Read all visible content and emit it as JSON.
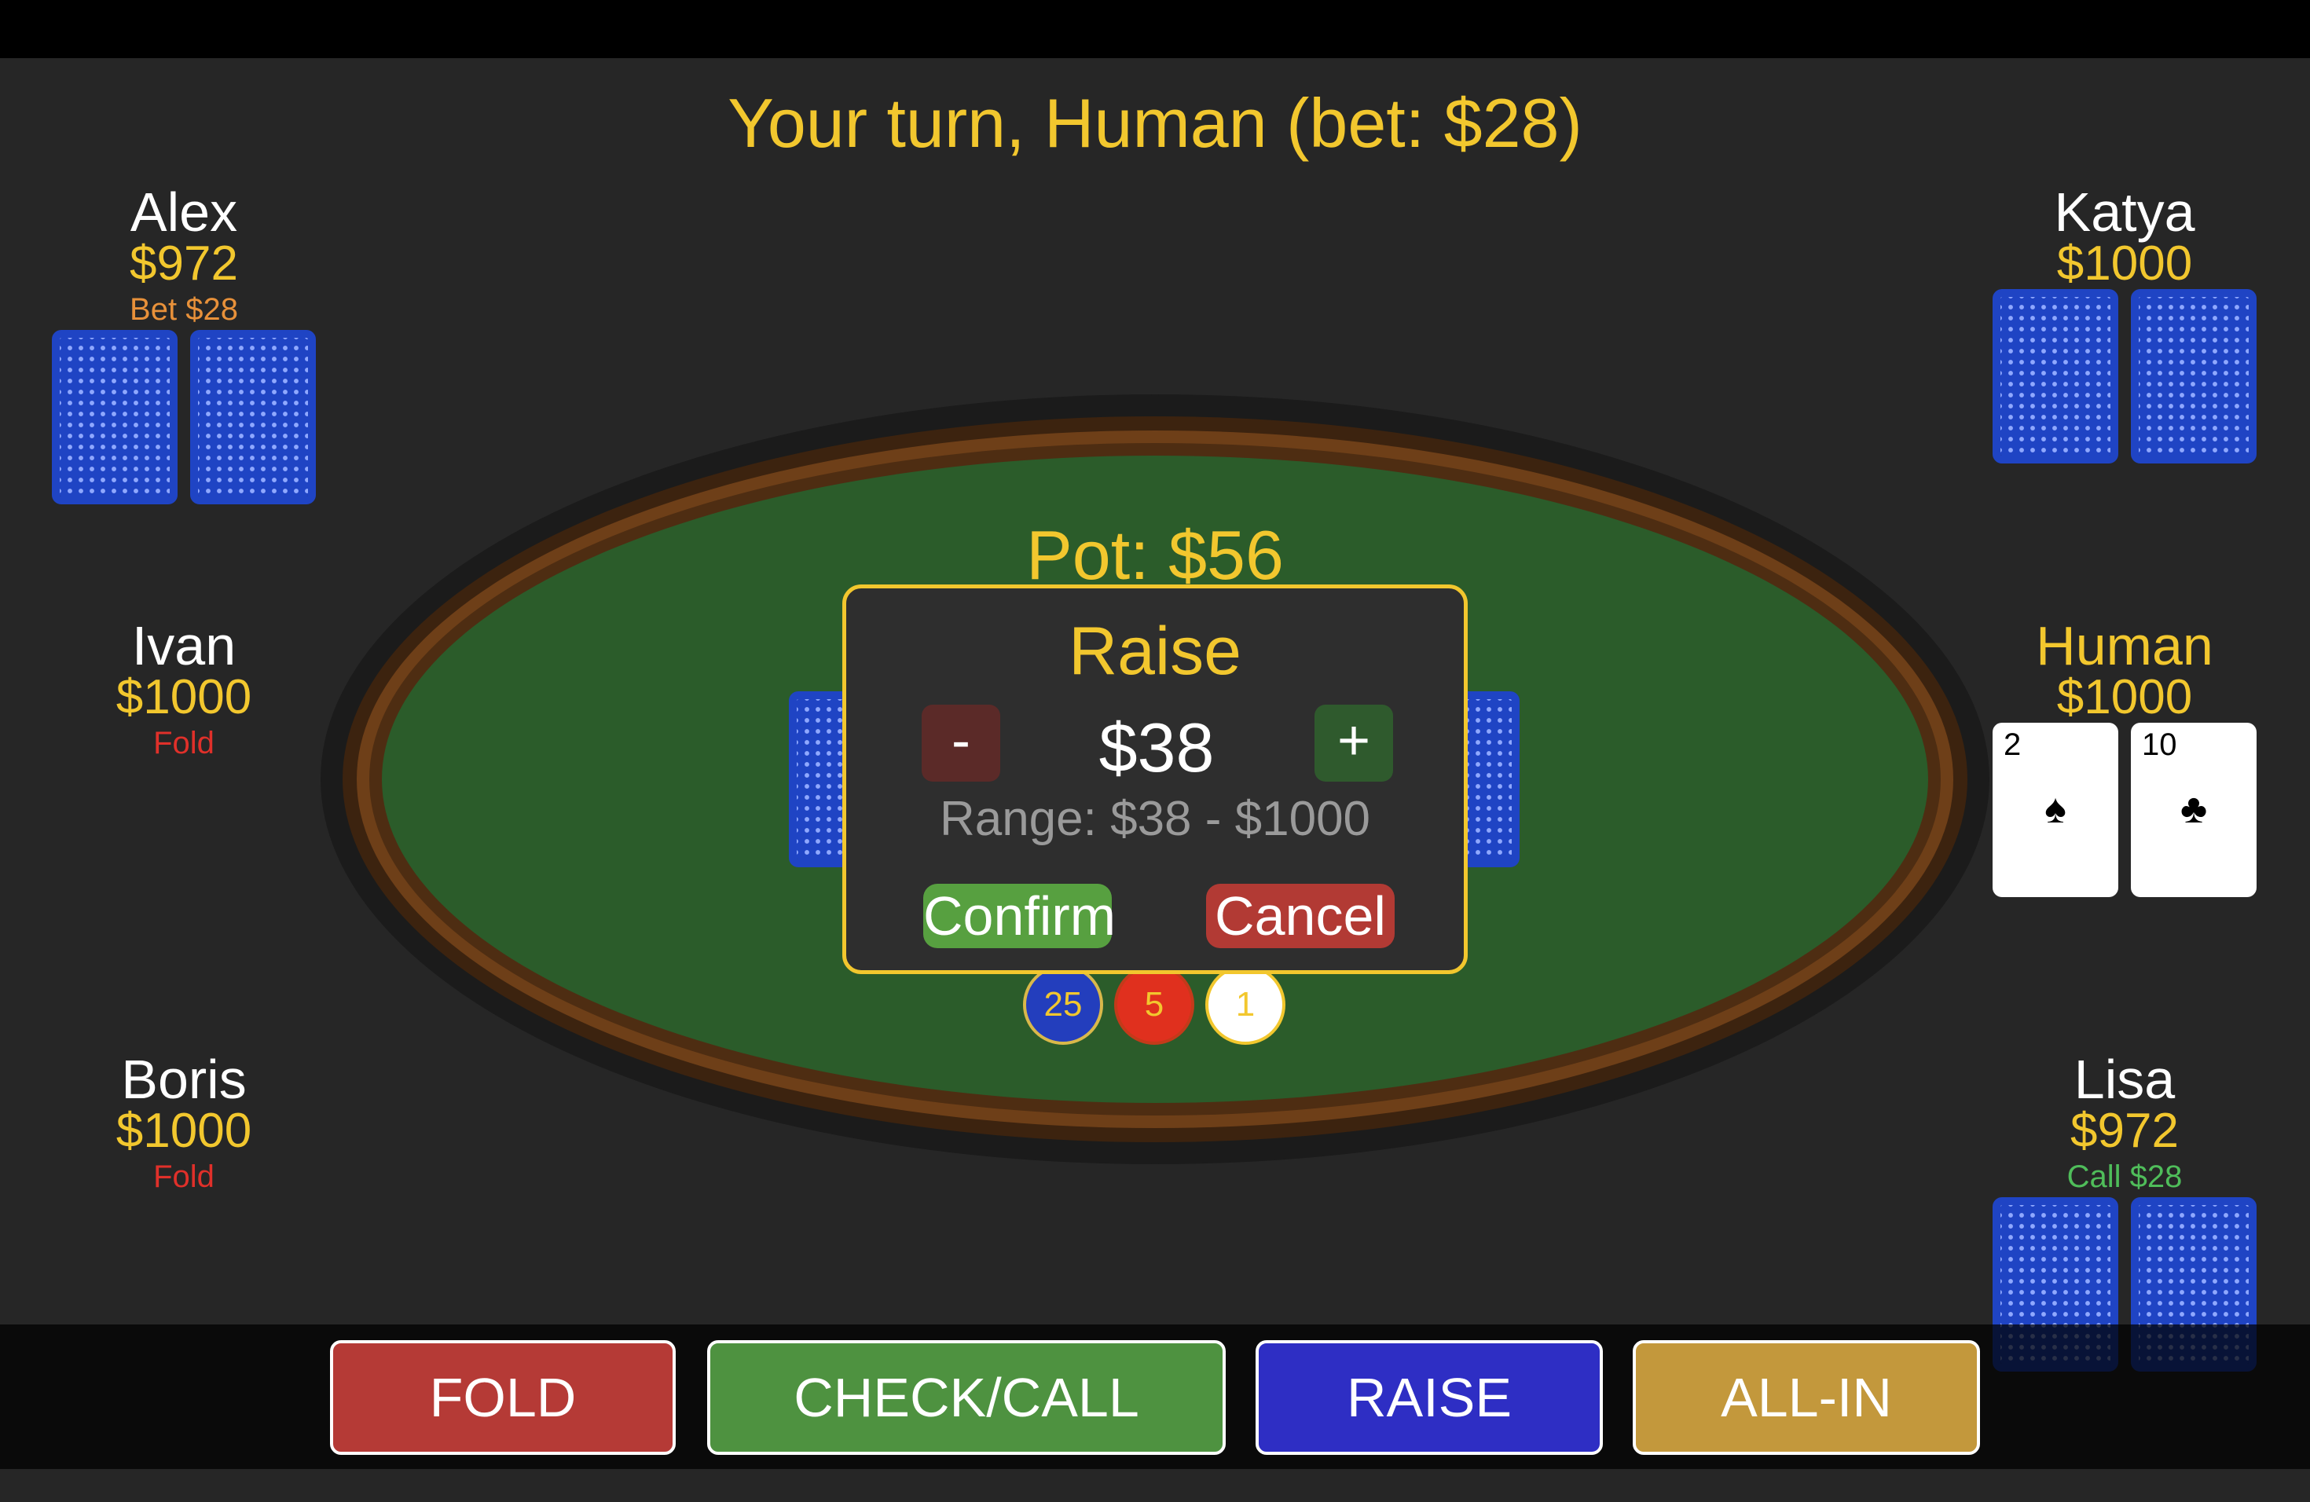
{
  "header": {
    "turn_text": "Your turn, Human (bet: $28)"
  },
  "table": {
    "pot_text": "Pot: $56"
  },
  "players": {
    "alex": {
      "name": "Alex",
      "chips": "$972",
      "status": "Bet $28"
    },
    "ivan": {
      "name": "Ivan",
      "chips": "$1000",
      "status": "Fold"
    },
    "boris": {
      "name": "Boris",
      "chips": "$1000",
      "status": "Fold"
    },
    "katya": {
      "name": "Katya",
      "chips": "$1000",
      "status": ""
    },
    "human": {
      "name": "Human",
      "chips": "$1000",
      "status": "",
      "cards": [
        {
          "rank": "2",
          "suit": "♠"
        },
        {
          "rank": "10",
          "suit": "♣"
        }
      ]
    },
    "lisa": {
      "name": "Lisa",
      "chips": "$972",
      "status": "Call $28"
    }
  },
  "chips_on_table": [
    "25",
    "5",
    "1"
  ],
  "raise_dialog": {
    "title": "Raise",
    "minus_label": "-",
    "plus_label": "+",
    "amount": "$38",
    "range_text": "Range: $38 - $1000",
    "confirm_label": "Confirm",
    "cancel_label": "Cancel"
  },
  "actions": {
    "fold_label": "FOLD",
    "check_call_label": "CHECK/CALL",
    "raise_label": "RAISE",
    "all_in_label": "ALL-IN"
  },
  "colors": {
    "accent_gold": "#f2c72e",
    "felt_green": "#2b5c2a",
    "card_back_blue": "#1f44c4",
    "fold_red": "#b53a36",
    "call_green": "#4e9240",
    "raise_blue": "#2e2ec4",
    "allin_gold": "#c3983c"
  }
}
